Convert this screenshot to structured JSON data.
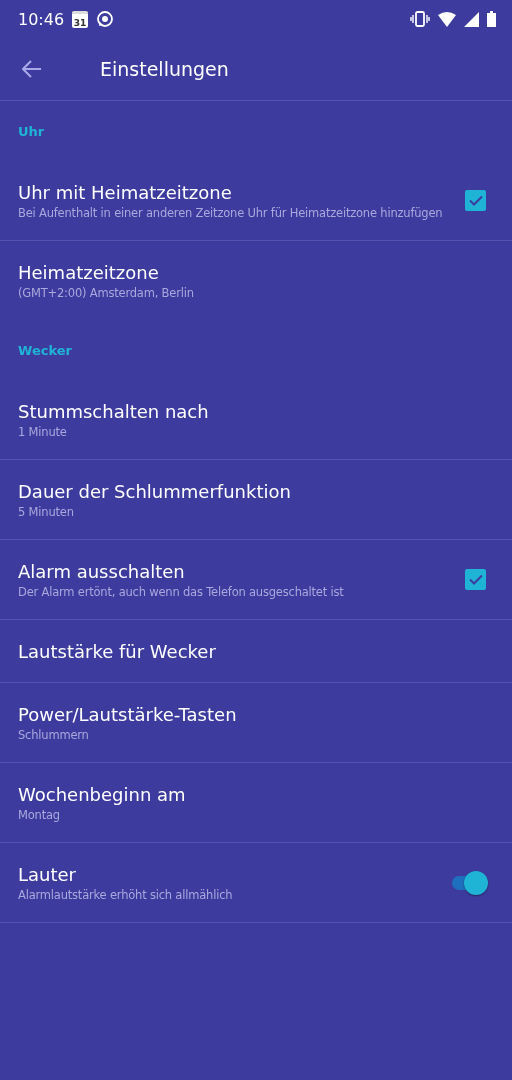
{
  "status_bar": {
    "time": "10:46",
    "calendar_day": "31"
  },
  "app_bar": {
    "title": "Einstellungen"
  },
  "sections": [
    {
      "title": "Uhr",
      "items": [
        {
          "kind": "checkbox",
          "title": "Uhr mit Heimatzeitzone",
          "subtitle": "Bei Aufenthalt in einer anderen Zeitzone Uhr für Heimatzeitzone hinzufügen",
          "checked": true
        },
        {
          "kind": "plain",
          "title": "Heimatzeitzone",
          "subtitle": "(GMT+2:00) Amsterdam, Berlin"
        }
      ]
    },
    {
      "title": "Wecker",
      "items": [
        {
          "kind": "plain",
          "title": "Stummschalten nach",
          "subtitle": "1 Minute"
        },
        {
          "kind": "plain",
          "title": "Dauer der Schlummerfunktion",
          "subtitle": "5 Minuten"
        },
        {
          "kind": "checkbox",
          "title": "Alarm ausschalten",
          "subtitle": "Der Alarm ertönt, auch wenn das Telefon ausgeschaltet ist",
          "checked": true
        },
        {
          "kind": "plain",
          "title": "Lautstärke für Wecker"
        },
        {
          "kind": "plain",
          "title": "Power/Lautstärke-Tasten",
          "subtitle": "Schlummern"
        },
        {
          "kind": "plain",
          "title": "Wochenbeginn am",
          "subtitle": "Montag"
        },
        {
          "kind": "switch",
          "title": "Lauter",
          "subtitle": "Alarmlautstärke erhöht sich allmählich",
          "on": true
        }
      ]
    }
  ]
}
